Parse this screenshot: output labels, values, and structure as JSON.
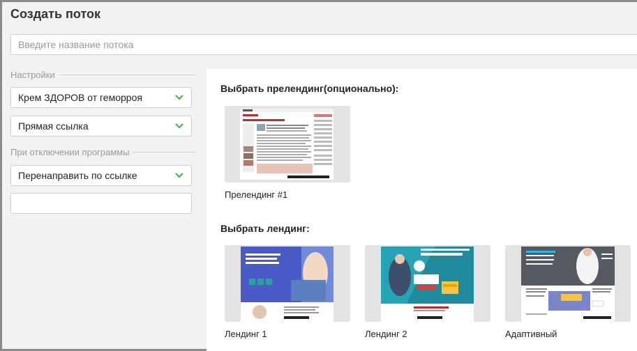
{
  "page": {
    "title": "Создать поток",
    "name_placeholder": "Введите название потока"
  },
  "settings": {
    "legend": "Настройки",
    "offer_select": "Крем ЗДОРОВ от геморроя",
    "link_type_select": "Прямая ссылка"
  },
  "disable": {
    "legend": "При отключении программы",
    "action_select": "Перенаправить по ссылке",
    "redirect_url": ""
  },
  "prelanding": {
    "title": "Выбрать прелендинг(опционально):",
    "items": [
      {
        "label": "Прелендинг #1"
      }
    ]
  },
  "landing": {
    "title": "Выбрать лендинг:",
    "items": [
      {
        "label": "Лендинг 1"
      },
      {
        "label": "Лендинг 2"
      },
      {
        "label": "Адаптивный"
      }
    ]
  },
  "colors": {
    "accent_green": "#4caf50",
    "panel_bg": "#f2f2f2"
  }
}
